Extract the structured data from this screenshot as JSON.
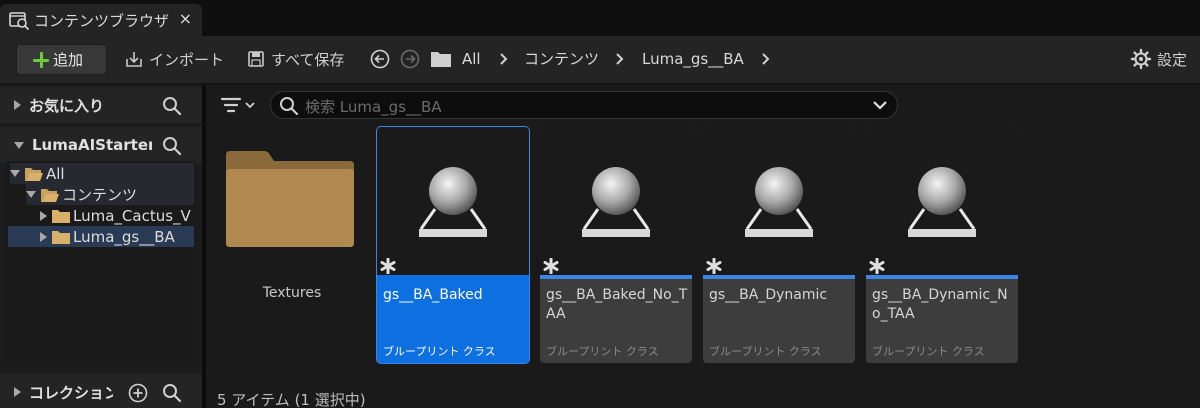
{
  "tab": {
    "title": "コンテンツブラウザ",
    "close": "×"
  },
  "toolbar": {
    "add_label": "追加",
    "import_label": "インポート",
    "save_all_label": "すべて保存",
    "settings_label": "設定"
  },
  "breadcrumb": [
    "All",
    "コンテンツ",
    "Luma_gs__BA"
  ],
  "sidebar": {
    "favorites_label": "お気に入り",
    "project_label": "LumaAIStarterP",
    "collections_label": "コレクション",
    "tree": [
      {
        "label": "All",
        "expanded": true
      },
      {
        "label": "コンテンツ",
        "expanded": true
      },
      {
        "label": "Luma_Cactus_V",
        "expanded": false
      },
      {
        "label": "Luma_gs__BA",
        "expanded": false,
        "selected": true
      }
    ]
  },
  "search": {
    "placeholder": "検索 Luma_gs__BA"
  },
  "assets": [
    {
      "kind": "folder",
      "name": "Textures"
    },
    {
      "kind": "blueprint",
      "name": "gs__BA_Baked",
      "type": "ブループリント クラス",
      "selected": true
    },
    {
      "kind": "blueprint",
      "name": "gs__BA_Baked_No_TAA",
      "type": "ブループリント クラス",
      "selected": false
    },
    {
      "kind": "blueprint",
      "name": "gs__BA_Dynamic",
      "type": "ブループリント クラス",
      "selected": false
    },
    {
      "kind": "blueprint",
      "name": "gs__BA_Dynamic_No_TAA",
      "type": "ブループリント クラス",
      "selected": false
    }
  ],
  "status": "5 アイテム (1 選択中)",
  "colors": {
    "accent": "#0d6fe0",
    "add_plus": "#6ecb3f",
    "folder": "#b08850",
    "asset_stripe": "#3a86e6"
  }
}
